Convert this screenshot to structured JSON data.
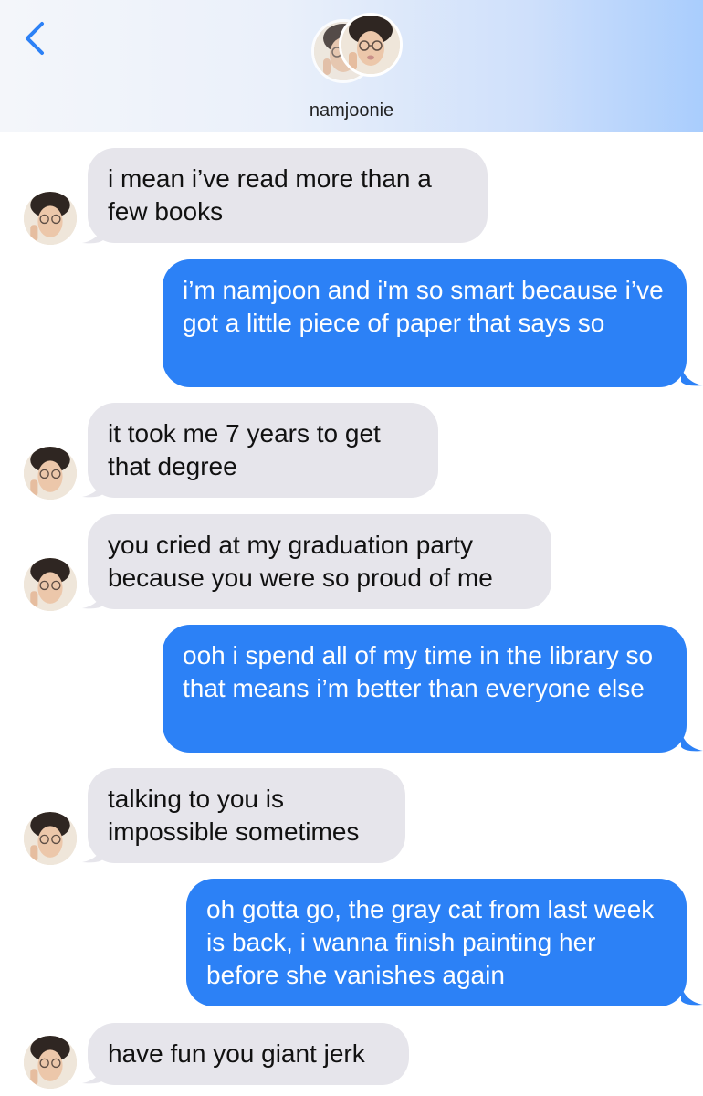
{
  "header": {
    "contact_name": "namjoonie",
    "back_icon": "chevron-left-icon",
    "accent_color": "#2c81f6"
  },
  "messages": [
    {
      "direction": "incoming",
      "text": "i mean i’ve read more than a few books"
    },
    {
      "direction": "outgoing",
      "text": "i’m namjoon and i'm so smart because i’ve got a little piece of paper that says so"
    },
    {
      "direction": "incoming",
      "text": "it took me 7 years to get that degree"
    },
    {
      "direction": "incoming",
      "text": "you cried at my graduation party because you were so proud of me"
    },
    {
      "direction": "outgoing",
      "text": "ooh i spend all of my time in the library so that means i’m better than everyone else"
    },
    {
      "direction": "incoming",
      "text": "talking to you is impossible sometimes"
    },
    {
      "direction": "outgoing",
      "text": "oh gotta go, the gray cat from last week is back, i wanna finish painting her before she vanishes again"
    },
    {
      "direction": "incoming",
      "text": "have fun you giant jerk"
    }
  ]
}
